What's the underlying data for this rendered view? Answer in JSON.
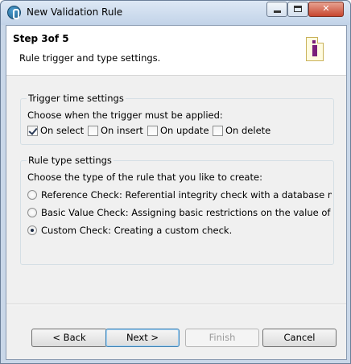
{
  "window": {
    "title": "New Validation Rule",
    "close_glyph": "✕"
  },
  "header": {
    "step": "Step 3of 5",
    "description": "Rule trigger and type settings.",
    "icon": "wizard-rule-icon"
  },
  "trigger": {
    "legend": "Trigger time settings",
    "prompt": "Choose when the trigger must be applied:",
    "options": [
      {
        "label": "On select",
        "checked": true
      },
      {
        "label": "On insert",
        "checked": false
      },
      {
        "label": "On update",
        "checked": false
      },
      {
        "label": "On delete",
        "checked": false
      }
    ]
  },
  "rule_type": {
    "legend": "Rule type settings",
    "prompt": "Choose the type of the rule that you like to create:",
    "options": [
      {
        "label": "Reference Check: Referential integrity check with a database metada",
        "selected": false
      },
      {
        "label": "Basic Value Check: Assigning basic restrictions on the value of the m",
        "selected": false
      },
      {
        "label": "Custom Check: Creating a custom check.",
        "selected": true
      }
    ]
  },
  "buttons": {
    "back": "< Back",
    "next": "Next >",
    "finish": "Finish",
    "cancel": "Cancel"
  },
  "colors": {
    "titlebar": "#c2d3e8",
    "dialog_bg": "#f0f0f0",
    "default_button_border": "#3c7fb1"
  }
}
